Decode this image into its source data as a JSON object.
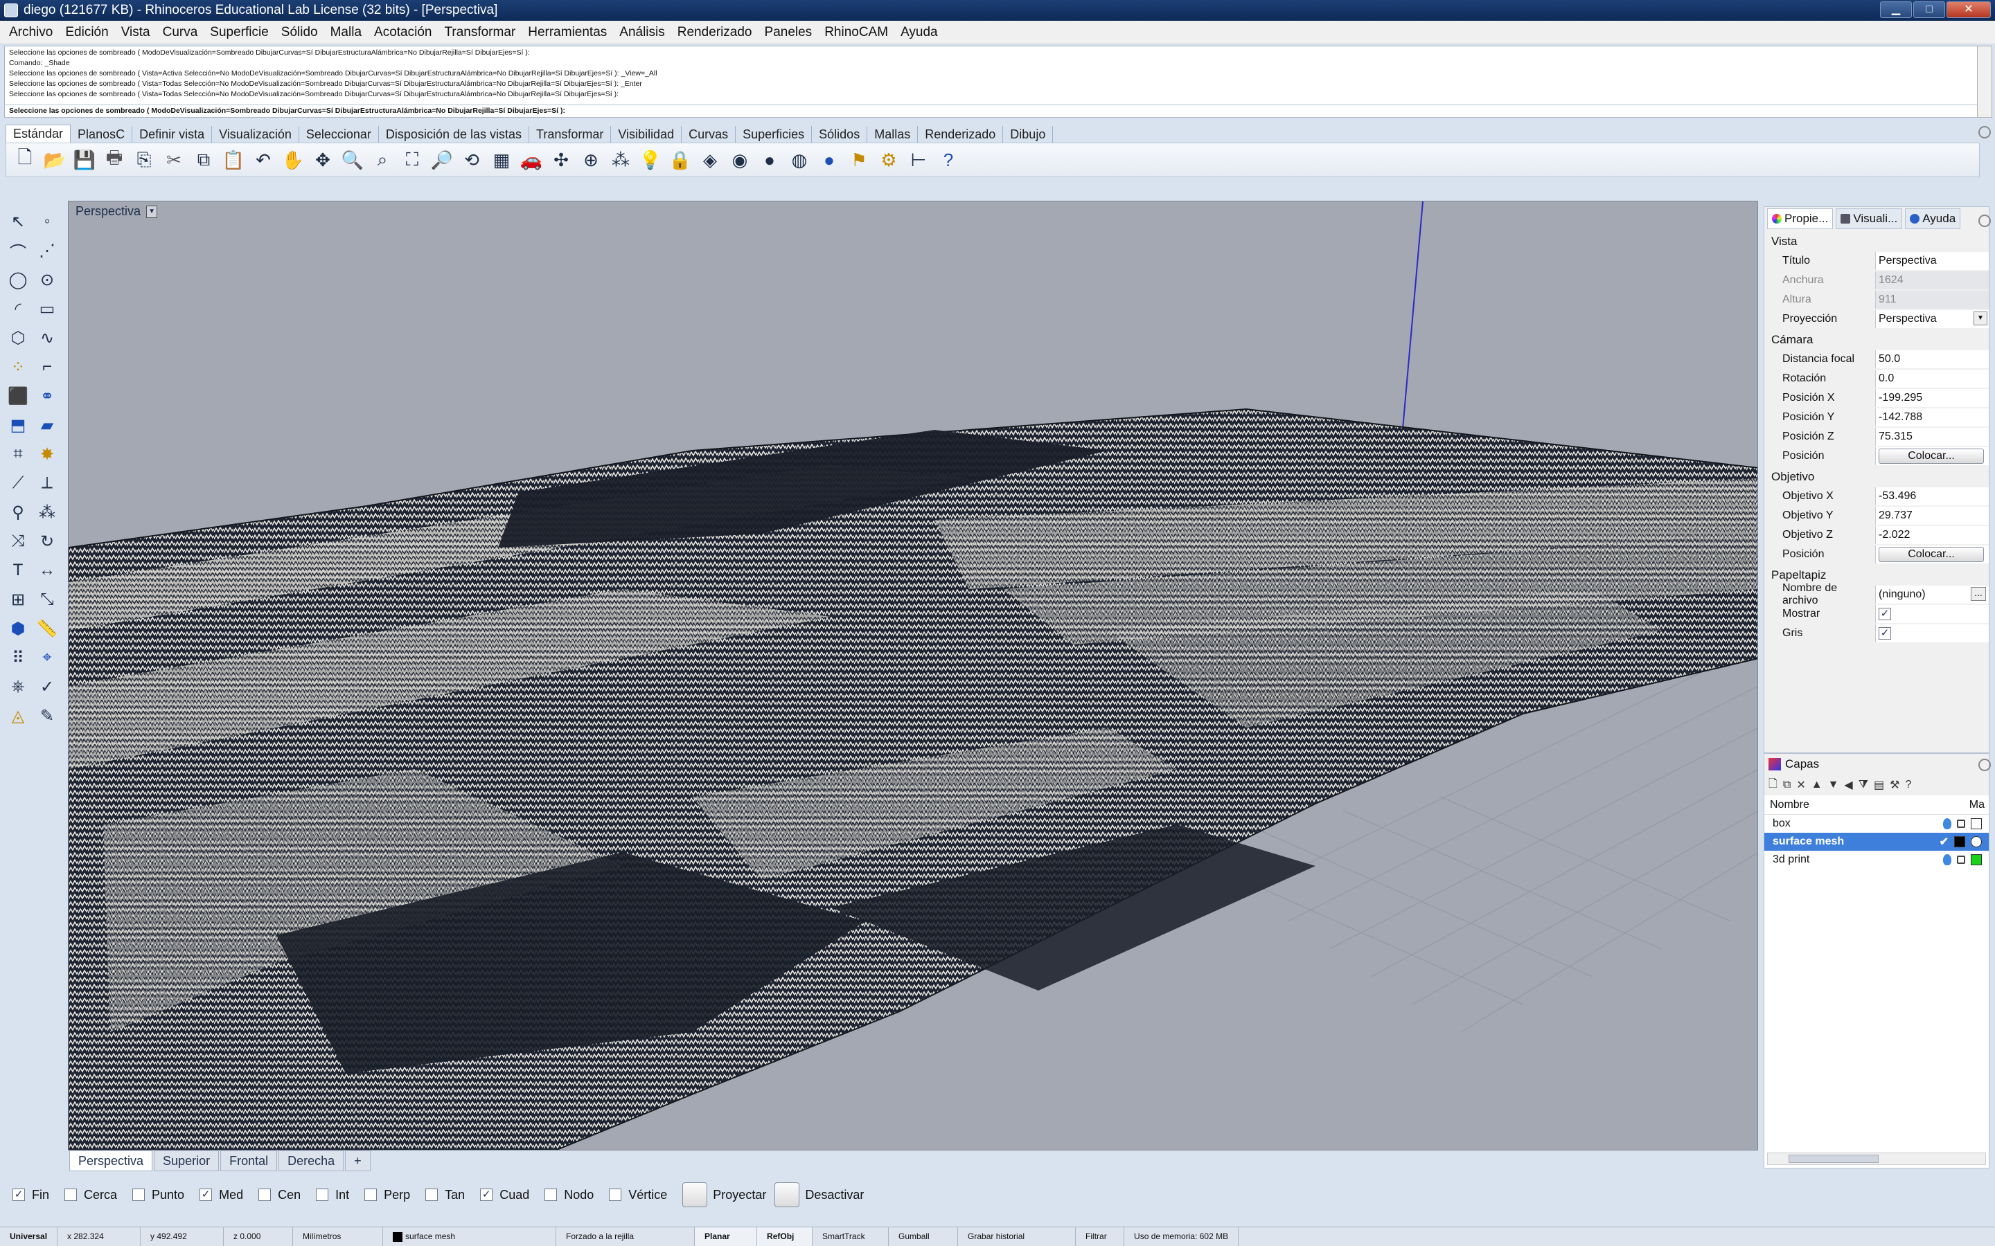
{
  "window": {
    "title": "diego (121677 KB) - Rhinoceros Educational Lab License (32 bits) - [Perspectiva]",
    "min_label": "▁",
    "max_label": "□",
    "close_label": "✕"
  },
  "menu": [
    "Archivo",
    "Edición",
    "Vista",
    "Curva",
    "Superficie",
    "Sólido",
    "Malla",
    "Acotación",
    "Transformar",
    "Herramientas",
    "Análisis",
    "Renderizado",
    "Paneles",
    "RhinoCAM",
    "Ayuda"
  ],
  "command_history": [
    "Seleccione las opciones de sombreado ( ModoDeVisualización=Sombreado  DibujarCurvas=Sí  DibujarEstructuraAlámbrica=No  DibujarRejilla=Sí  DibujarEjes=Sí ):",
    "Comando: _Shade",
    "Seleccione las opciones de sombreado ( Vista=Activa  Selección=No  ModoDeVisualización=Sombreado  DibujarCurvas=Sí  DibujarEstructuraAlámbrica=No  DibujarRejilla=Sí  DibujarEjes=Sí ): _View=_All",
    "Seleccione las opciones de sombreado ( Vista=Todas  Selección=No  ModoDeVisualización=Sombreado  DibujarCurvas=Sí  DibujarEstructuraAlámbrica=No  DibujarRejilla=Sí  DibujarEjes=Sí ): _Enter",
    "Seleccione las opciones de sombreado ( Vista=Todas  Selección=No  ModoDeVisualización=Sombreado  DibujarCurvas=Sí  DibujarEstructuraAlámbrica=No  DibujarRejilla=Sí  DibujarEjes=Sí ):"
  ],
  "command_prompt": "Seleccione las opciones de sombreado ( ModoDeVisualización=Sombreado  DibujarCurvas=Sí  DibujarEstructuraAlámbrica=No  DibujarRejilla=Sí  DibujarEjes=Sí ):",
  "toolbar_tabs": [
    "Estándar",
    "PlanosC",
    "Definir vista",
    "Visualización",
    "Seleccionar",
    "Disposición de las vistas",
    "Transformar",
    "Visibilidad",
    "Curvas",
    "Superficies",
    "Sólidos",
    "Mallas",
    "Renderizado",
    "Dibujo"
  ],
  "standard_tools": [
    {
      "icon": "new-file-icon",
      "glyph": "🗋"
    },
    {
      "icon": "open-folder-icon",
      "glyph": "📂"
    },
    {
      "icon": "save-icon",
      "glyph": "💾"
    },
    {
      "icon": "print-icon",
      "glyph": "🖶"
    },
    {
      "icon": "import-icon",
      "glyph": "⎘"
    },
    {
      "icon": "cut-icon",
      "glyph": "✂"
    },
    {
      "icon": "copy-icon",
      "glyph": "⧉"
    },
    {
      "icon": "paste-icon",
      "glyph": "📋"
    },
    {
      "icon": "undo-icon",
      "glyph": "↶"
    },
    {
      "icon": "pan-hand-icon",
      "glyph": "✋"
    },
    {
      "icon": "move-view-icon",
      "glyph": "✥"
    },
    {
      "icon": "zoom-icon",
      "glyph": "🔍"
    },
    {
      "icon": "zoom-window-icon",
      "glyph": "⌕"
    },
    {
      "icon": "zoom-extents-icon",
      "glyph": "⛶"
    },
    {
      "icon": "zoom-selected-icon",
      "glyph": "🔎"
    },
    {
      "icon": "rotate-view-icon",
      "glyph": "⟲"
    },
    {
      "icon": "viewport-layout-icon",
      "glyph": "▦"
    },
    {
      "icon": "car-icon",
      "glyph": "🚗"
    },
    {
      "icon": "object-snap-icon",
      "glyph": "✣"
    },
    {
      "icon": "cplane-icon",
      "glyph": "⊕"
    },
    {
      "icon": "select-points-icon",
      "glyph": "⁂"
    },
    {
      "icon": "light-bulb-icon",
      "glyph": "💡"
    },
    {
      "icon": "lock-icon",
      "glyph": "🔒"
    },
    {
      "icon": "layer-icon",
      "glyph": "◈"
    },
    {
      "icon": "color-wheel-icon",
      "glyph": "◉"
    },
    {
      "icon": "material-sphere-icon",
      "glyph": "●"
    },
    {
      "icon": "render-sphere-icon",
      "glyph": "◍"
    },
    {
      "icon": "render-blue-sphere-icon",
      "glyph": "●"
    },
    {
      "icon": "flag-icon",
      "glyph": "⚑"
    },
    {
      "icon": "options-gear-icon",
      "glyph": "⚙"
    },
    {
      "icon": "dimension-icon",
      "glyph": "⊢"
    },
    {
      "icon": "help-icon",
      "glyph": "?"
    }
  ],
  "left_tools": [
    {
      "icon": "select-arrow-icon",
      "glyph": "↖"
    },
    {
      "icon": "point-icon",
      "glyph": "◦"
    },
    {
      "icon": "polyline-icon",
      "glyph": "⌒"
    },
    {
      "icon": "curve-points-icon",
      "glyph": "⋰"
    },
    {
      "icon": "circle-icon",
      "glyph": "◯"
    },
    {
      "icon": "ellipse-icon",
      "glyph": "⊙"
    },
    {
      "icon": "arc-icon",
      "glyph": "◜"
    },
    {
      "icon": "rectangle-icon",
      "glyph": "▭"
    },
    {
      "icon": "polygon-icon",
      "glyph": "⬡"
    },
    {
      "icon": "freeform-curve-icon",
      "glyph": "∿"
    },
    {
      "icon": "point-cloud-icon",
      "glyph": "⁘"
    },
    {
      "icon": "fillet-icon",
      "glyph": "⌐"
    },
    {
      "icon": "box-solid-icon",
      "glyph": "⬛"
    },
    {
      "icon": "boolean-icon",
      "glyph": "⚭"
    },
    {
      "icon": "extrude-icon",
      "glyph": "⬒"
    },
    {
      "icon": "surface-icon",
      "glyph": "▰"
    },
    {
      "icon": "mesh-icon",
      "glyph": "⌗"
    },
    {
      "icon": "explode-icon",
      "glyph": "✸"
    },
    {
      "icon": "trim-icon",
      "glyph": "⟋"
    },
    {
      "icon": "split-icon",
      "glyph": "⟂"
    },
    {
      "icon": "join-icon",
      "glyph": "⚲"
    },
    {
      "icon": "group-icon",
      "glyph": "⁂"
    },
    {
      "icon": "move-icon",
      "glyph": "⤨"
    },
    {
      "icon": "rotate-icon",
      "glyph": "↻"
    },
    {
      "icon": "text-icon",
      "glyph": "T"
    },
    {
      "icon": "dimension-left-icon",
      "glyph": "↔"
    },
    {
      "icon": "array-icon",
      "glyph": "⊞"
    },
    {
      "icon": "scale-icon",
      "glyph": "⤡"
    },
    {
      "icon": "block-icon",
      "glyph": "⬢"
    },
    {
      "icon": "ruler-icon",
      "glyph": "📏"
    },
    {
      "icon": "grid-points-icon",
      "glyph": "⠿"
    },
    {
      "icon": "gumball-icon",
      "glyph": "⌖"
    },
    {
      "icon": "analyze-icon",
      "glyph": "⎈"
    },
    {
      "icon": "check-icon",
      "glyph": "✓"
    },
    {
      "icon": "render-icon",
      "glyph": "◬"
    },
    {
      "icon": "drawing-icon",
      "glyph": "✎"
    }
  ],
  "viewport": {
    "label": "Perspectiva",
    "tabs": [
      "Perspectiva",
      "Superior",
      "Frontal",
      "Derecha"
    ],
    "add_tab": "+"
  },
  "osnaps": [
    {
      "label": "Fin",
      "checked": true
    },
    {
      "label": "Cerca",
      "checked": false
    },
    {
      "label": "Punto",
      "checked": false
    },
    {
      "label": "Med",
      "checked": true
    },
    {
      "label": "Cen",
      "checked": false
    },
    {
      "label": "Int",
      "checked": false
    },
    {
      "label": "Perp",
      "checked": false
    },
    {
      "label": "Tan",
      "checked": false
    },
    {
      "label": "Cuad",
      "checked": true
    },
    {
      "label": "Nodo",
      "checked": false
    },
    {
      "label": "Vértice",
      "checked": false
    }
  ],
  "osnap_buttons": [
    "Proyectar",
    "Desactivar"
  ],
  "status": {
    "cplane": "Universal",
    "x": "x 282.324",
    "y": "y 492.492",
    "z": "z 0.000",
    "units": "Milímetros",
    "layer": "surface mesh",
    "grid_snap": "Forzado a la rejilla",
    "planar": "Planar",
    "osnap": "RefObj",
    "smarttrack": "SmartTrack",
    "gumball": "Gumball",
    "history": "Grabar historial",
    "filter": "Filtrar",
    "memory": "Uso de memoria: 602 MB"
  },
  "properties": {
    "tabs": [
      "Propie...",
      "Visuali...",
      "Ayuda"
    ],
    "sections": {
      "view": "Vista",
      "camera": "Cámara",
      "target": "Objetivo",
      "wallpaper": "Papeltapiz"
    },
    "view_rows": [
      {
        "k": "Título",
        "v": "Perspectiva"
      },
      {
        "k": "Anchura",
        "v": "1624",
        "grey": true
      },
      {
        "k": "Altura",
        "v": "911",
        "grey": true
      },
      {
        "k": "Proyección",
        "v": "Perspectiva",
        "dropdown": true
      }
    ],
    "camera_rows": [
      {
        "k": "Distancia focal",
        "v": "50.0"
      },
      {
        "k": "Rotación",
        "v": "0.0"
      },
      {
        "k": "Posición X",
        "v": "-199.295"
      },
      {
        "k": "Posición Y",
        "v": "-142.788"
      },
      {
        "k": "Posición Z",
        "v": "75.315"
      },
      {
        "k": "Posición",
        "button": "Colocar..."
      }
    ],
    "target_rows": [
      {
        "k": "Objetivo X",
        "v": "-53.496"
      },
      {
        "k": "Objetivo Y",
        "v": "29.737"
      },
      {
        "k": "Objetivo Z",
        "v": "-2.022"
      },
      {
        "k": "Posición",
        "button": "Colocar..."
      }
    ],
    "wallpaper_rows": [
      {
        "k": "Nombre de archivo",
        "v": "(ninguno)",
        "more": "..."
      },
      {
        "k": "Mostrar",
        "check": true
      },
      {
        "k": "Gris",
        "check": true
      }
    ]
  },
  "layers": {
    "title": "Capas",
    "col_name": "Nombre",
    "col_mat": "Ma",
    "rows": [
      {
        "name": "box",
        "selected": false,
        "color": "#ffffff",
        "current": ""
      },
      {
        "name": "surface mesh",
        "selected": true,
        "color": "#000000",
        "current": "✔"
      },
      {
        "name": "3d print",
        "selected": false,
        "color": "#19d219",
        "current": ""
      }
    ]
  },
  "colors": {
    "title_bar": "#0d2a57",
    "viewport_bg": "#a3a8b2",
    "selection": "#3f7fdc",
    "terrain_dark": "#1d2330",
    "terrain_light": "#e8e6e0"
  }
}
